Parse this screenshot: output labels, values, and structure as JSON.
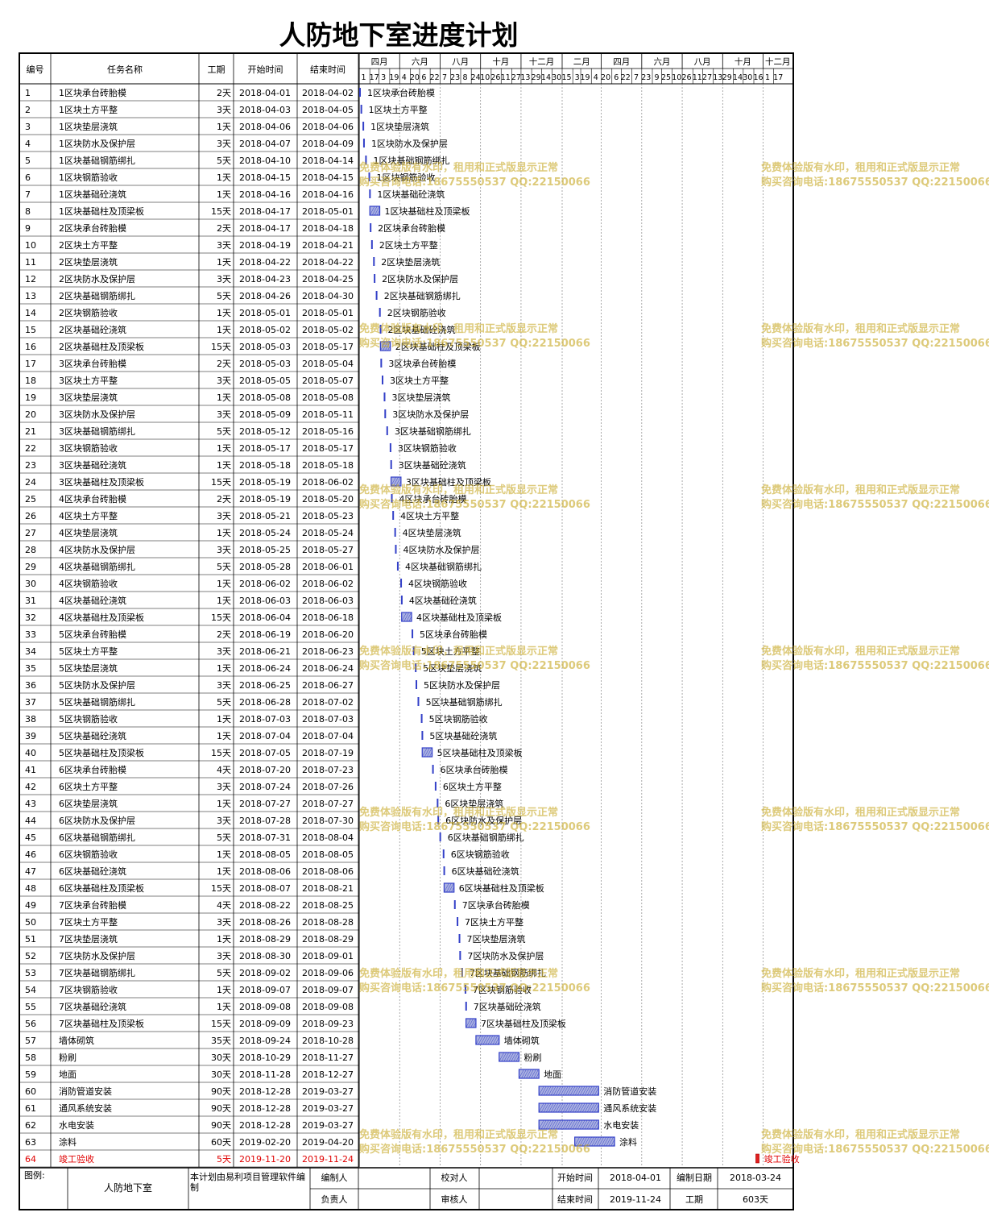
{
  "title": "人防地下室进度计划",
  "headers": {
    "id": "编号",
    "name": "任务名称",
    "duration": "工期",
    "start": "开始时间",
    "end": "结束时间"
  },
  "months": [
    "四月",
    "六月",
    "八月",
    "十月",
    "十二月",
    "二月",
    "四月",
    "六月",
    "八月",
    "十月",
    "十二月"
  ],
  "days": [
    "1",
    "17",
    "3",
    "19",
    "4",
    "20",
    "6",
    "22",
    "7",
    "23",
    "8",
    "24",
    "10",
    "26",
    "11",
    "27",
    "13",
    "29",
    "14",
    "30",
    "15",
    "3",
    "19",
    "4",
    "20",
    "6",
    "22",
    "7",
    "23",
    "9",
    "25",
    "10",
    "26",
    "11",
    "27",
    "13",
    "29",
    "14",
    "30",
    "16",
    "1",
    "17"
  ],
  "watermark": {
    "line1": "免费体验版有水印，租用和正式版显示正常",
    "line2": "购买咨询电话:18675550537 QQ:22150066"
  },
  "colors": {
    "bar": "#3340c8",
    "bar_fill": "#a9b0e0",
    "milestone": "#e02020",
    "milestone_text": "#e00000",
    "watermark": "#c8aa28"
  },
  "chart_data": {
    "type": "gantt",
    "title": "人防地下室进度计划",
    "x_range": [
      "2018-04-01",
      "2019-11-27"
    ],
    "timescale": "half-month",
    "grid": true,
    "tasks": [
      {
        "id": "1",
        "name": "1区块承台砖胎模",
        "duration": "2天",
        "start": "2018-04-01",
        "end": "2018-04-02"
      },
      {
        "id": "2",
        "name": "1区块土方平整",
        "duration": "3天",
        "start": "2018-04-03",
        "end": "2018-04-05"
      },
      {
        "id": "3",
        "name": "1区块垫层浇筑",
        "duration": "1天",
        "start": "2018-04-06",
        "end": "2018-04-06"
      },
      {
        "id": "4",
        "name": "1区块防水及保护层",
        "duration": "3天",
        "start": "2018-04-07",
        "end": "2018-04-09"
      },
      {
        "id": "5",
        "name": "1区块基础钢筋绑扎",
        "duration": "5天",
        "start": "2018-04-10",
        "end": "2018-04-14"
      },
      {
        "id": "6",
        "name": "1区块钢筋验收",
        "duration": "1天",
        "start": "2018-04-15",
        "end": "2018-04-15"
      },
      {
        "id": "7",
        "name": "1区块基础砼浇筑",
        "duration": "1天",
        "start": "2018-04-16",
        "end": "2018-04-16"
      },
      {
        "id": "8",
        "name": "1区块基础柱及顶梁板",
        "duration": "15天",
        "start": "2018-04-17",
        "end": "2018-05-01"
      },
      {
        "id": "9",
        "name": "2区块承台砖胎模",
        "duration": "2天",
        "start": "2018-04-17",
        "end": "2018-04-18"
      },
      {
        "id": "10",
        "name": "2区块土方平整",
        "duration": "3天",
        "start": "2018-04-19",
        "end": "2018-04-21"
      },
      {
        "id": "11",
        "name": "2区块垫层浇筑",
        "duration": "1天",
        "start": "2018-04-22",
        "end": "2018-04-22"
      },
      {
        "id": "12",
        "name": "2区块防水及保护层",
        "duration": "3天",
        "start": "2018-04-23",
        "end": "2018-04-25"
      },
      {
        "id": "13",
        "name": "2区块基础钢筋绑扎",
        "duration": "5天",
        "start": "2018-04-26",
        "end": "2018-04-30"
      },
      {
        "id": "14",
        "name": "2区块钢筋验收",
        "duration": "1天",
        "start": "2018-05-01",
        "end": "2018-05-01"
      },
      {
        "id": "15",
        "name": "2区块基础砼浇筑",
        "duration": "1天",
        "start": "2018-05-02",
        "end": "2018-05-02"
      },
      {
        "id": "16",
        "name": "2区块基础柱及顶梁板",
        "duration": "15天",
        "start": "2018-05-03",
        "end": "2018-05-17"
      },
      {
        "id": "17",
        "name": "3区块承台砖胎模",
        "duration": "2天",
        "start": "2018-05-03",
        "end": "2018-05-04"
      },
      {
        "id": "18",
        "name": "3区块土方平整",
        "duration": "3天",
        "start": "2018-05-05",
        "end": "2018-05-07"
      },
      {
        "id": "19",
        "name": "3区块垫层浇筑",
        "duration": "1天",
        "start": "2018-05-08",
        "end": "2018-05-08"
      },
      {
        "id": "20",
        "name": "3区块防水及保护层",
        "duration": "3天",
        "start": "2018-05-09",
        "end": "2018-05-11"
      },
      {
        "id": "21",
        "name": "3区块基础钢筋绑扎",
        "duration": "5天",
        "start": "2018-05-12",
        "end": "2018-05-16"
      },
      {
        "id": "22",
        "name": "3区块钢筋验收",
        "duration": "1天",
        "start": "2018-05-17",
        "end": "2018-05-17"
      },
      {
        "id": "23",
        "name": "3区块基础砼浇筑",
        "duration": "1天",
        "start": "2018-05-18",
        "end": "2018-05-18"
      },
      {
        "id": "24",
        "name": "3区块基础柱及顶梁板",
        "duration": "15天",
        "start": "2018-05-19",
        "end": "2018-06-02"
      },
      {
        "id": "25",
        "name": "4区块承台砖胎模",
        "duration": "2天",
        "start": "2018-05-19",
        "end": "2018-05-20"
      },
      {
        "id": "26",
        "name": "4区块土方平整",
        "duration": "3天",
        "start": "2018-05-21",
        "end": "2018-05-23"
      },
      {
        "id": "27",
        "name": "4区块垫层浇筑",
        "duration": "1天",
        "start": "2018-05-24",
        "end": "2018-05-24"
      },
      {
        "id": "28",
        "name": "4区块防水及保护层",
        "duration": "3天",
        "start": "2018-05-25",
        "end": "2018-05-27"
      },
      {
        "id": "29",
        "name": "4区块基础钢筋绑扎",
        "duration": "5天",
        "start": "2018-05-28",
        "end": "2018-06-01"
      },
      {
        "id": "30",
        "name": "4区块钢筋验收",
        "duration": "1天",
        "start": "2018-06-02",
        "end": "2018-06-02"
      },
      {
        "id": "31",
        "name": "4区块基础砼浇筑",
        "duration": "1天",
        "start": "2018-06-03",
        "end": "2018-06-03"
      },
      {
        "id": "32",
        "name": "4区块基础柱及顶梁板",
        "duration": "15天",
        "start": "2018-06-04",
        "end": "2018-06-18"
      },
      {
        "id": "33",
        "name": "5区块承台砖胎模",
        "duration": "2天",
        "start": "2018-06-19",
        "end": "2018-06-20"
      },
      {
        "id": "34",
        "name": "5区块土方平整",
        "duration": "3天",
        "start": "2018-06-21",
        "end": "2018-06-23"
      },
      {
        "id": "35",
        "name": "5区块垫层浇筑",
        "duration": "1天",
        "start": "2018-06-24",
        "end": "2018-06-24"
      },
      {
        "id": "36",
        "name": "5区块防水及保护层",
        "duration": "3天",
        "start": "2018-06-25",
        "end": "2018-06-27"
      },
      {
        "id": "37",
        "name": "5区块基础钢筋绑扎",
        "duration": "5天",
        "start": "2018-06-28",
        "end": "2018-07-02"
      },
      {
        "id": "38",
        "name": "5区块钢筋验收",
        "duration": "1天",
        "start": "2018-07-03",
        "end": "2018-07-03"
      },
      {
        "id": "39",
        "name": "5区块基础砼浇筑",
        "duration": "1天",
        "start": "2018-07-04",
        "end": "2018-07-04"
      },
      {
        "id": "40",
        "name": "5区块基础柱及顶梁板",
        "duration": "15天",
        "start": "2018-07-05",
        "end": "2018-07-19"
      },
      {
        "id": "41",
        "name": "6区块承台砖胎模",
        "duration": "4天",
        "start": "2018-07-20",
        "end": "2018-07-23"
      },
      {
        "id": "42",
        "name": "6区块土方平整",
        "duration": "3天",
        "start": "2018-07-24",
        "end": "2018-07-26"
      },
      {
        "id": "43",
        "name": "6区块垫层浇筑",
        "duration": "1天",
        "start": "2018-07-27",
        "end": "2018-07-27"
      },
      {
        "id": "44",
        "name": "6区块防水及保护层",
        "duration": "3天",
        "start": "2018-07-28",
        "end": "2018-07-30"
      },
      {
        "id": "45",
        "name": "6区块基础钢筋绑扎",
        "duration": "5天",
        "start": "2018-07-31",
        "end": "2018-08-04"
      },
      {
        "id": "46",
        "name": "6区块钢筋验收",
        "duration": "1天",
        "start": "2018-08-05",
        "end": "2018-08-05"
      },
      {
        "id": "47",
        "name": "6区块基础砼浇筑",
        "duration": "1天",
        "start": "2018-08-06",
        "end": "2018-08-06"
      },
      {
        "id": "48",
        "name": "6区块基础柱及顶梁板",
        "duration": "15天",
        "start": "2018-08-07",
        "end": "2018-08-21"
      },
      {
        "id": "49",
        "name": "7区块承台砖胎模",
        "duration": "4天",
        "start": "2018-08-22",
        "end": "2018-08-25"
      },
      {
        "id": "50",
        "name": "7区块土方平整",
        "duration": "3天",
        "start": "2018-08-26",
        "end": "2018-08-28"
      },
      {
        "id": "51",
        "name": "7区块垫层浇筑",
        "duration": "1天",
        "start": "2018-08-29",
        "end": "2018-08-29"
      },
      {
        "id": "52",
        "name": "7区块防水及保护层",
        "duration": "3天",
        "start": "2018-08-30",
        "end": "2018-09-01"
      },
      {
        "id": "53",
        "name": "7区块基础钢筋绑扎",
        "duration": "5天",
        "start": "2018-09-02",
        "end": "2018-09-06"
      },
      {
        "id": "54",
        "name": "7区块钢筋验收",
        "duration": "1天",
        "start": "2018-09-07",
        "end": "2018-09-07"
      },
      {
        "id": "55",
        "name": "7区块基础砼浇筑",
        "duration": "1天",
        "start": "2018-09-08",
        "end": "2018-09-08"
      },
      {
        "id": "56",
        "name": "7区块基础柱及顶梁板",
        "duration": "15天",
        "start": "2018-09-09",
        "end": "2018-09-23"
      },
      {
        "id": "57",
        "name": "墙体砌筑",
        "duration": "35天",
        "start": "2018-09-24",
        "end": "2018-10-28"
      },
      {
        "id": "58",
        "name": "粉刷",
        "duration": "30天",
        "start": "2018-10-29",
        "end": "2018-11-27"
      },
      {
        "id": "59",
        "name": "地面",
        "duration": "30天",
        "start": "2018-11-28",
        "end": "2018-12-27"
      },
      {
        "id": "60",
        "name": "消防管道安装",
        "duration": "90天",
        "start": "2018-12-28",
        "end": "2019-03-27"
      },
      {
        "id": "61",
        "name": "通风系统安装",
        "duration": "90天",
        "start": "2018-12-28",
        "end": "2019-03-27"
      },
      {
        "id": "62",
        "name": "水电安装",
        "duration": "90天",
        "start": "2018-12-28",
        "end": "2019-03-27"
      },
      {
        "id": "63",
        "name": "涂料",
        "duration": "60天",
        "start": "2019-02-20",
        "end": "2019-04-20"
      },
      {
        "id": "64",
        "name": "竣工验收",
        "duration": "5天",
        "start": "2019-11-20",
        "end": "2019-11-24",
        "milestone": true
      }
    ]
  },
  "footer": {
    "legend_label": "图例:",
    "project": "人防地下室",
    "note": "本计划由易利项目管理软件编制",
    "editor_label": "编制人",
    "editor": "",
    "checker_label": "校对人",
    "checker": "",
    "owner_label": "负责人",
    "owner": "",
    "reviewer_label": "审核人",
    "reviewer": "",
    "start_label": "开始时间",
    "start": "2018-04-01",
    "end_label": "结束时间",
    "end": "2019-11-24",
    "date_label": "编制日期",
    "date": "2018-03-24",
    "duration_label": "工期",
    "duration": "603天"
  }
}
